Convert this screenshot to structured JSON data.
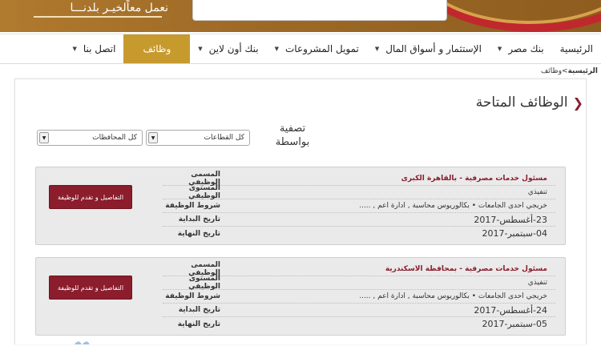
{
  "header": {
    "slogan": "نعمل معاًلخيـر بلدنـــا"
  },
  "nav": {
    "items": [
      {
        "label": "الرئيسية",
        "dropdown": false,
        "active": false
      },
      {
        "label": "بنك مصر",
        "dropdown": true,
        "active": false
      },
      {
        "label": "الإستثمار و أسواق المال",
        "dropdown": true,
        "active": false
      },
      {
        "label": "تمويل المشروعات",
        "dropdown": true,
        "active": false
      },
      {
        "label": "بنك أون لاين",
        "dropdown": true,
        "active": false
      },
      {
        "label": "وظائف",
        "dropdown": false,
        "active": true
      },
      {
        "label": "اتصل بنا",
        "dropdown": true,
        "active": false
      }
    ],
    "arrow_icon": "caret-down-icon"
  },
  "breadcrumb": {
    "home": "الرئيسية",
    "separator": ">",
    "current": "وظائف"
  },
  "page": {
    "title": "الوظائف المتاحة"
  },
  "filter": {
    "label": "تصفية بواسطة",
    "sector_value": "كل القطاعات",
    "governorate_value": "كل المحافظات"
  },
  "labels": {
    "title": "المسمى الوظيفي",
    "level": "المستوى الوظيفي",
    "conditions": "شروط الوظيفة",
    "start": "تاريخ البداية",
    "end": "تاريخ النهاية",
    "apply": "التفاصيل و تقدم للوظيفة"
  },
  "jobs": [
    {
      "title": "مسئول خدمات مصرفية - بالقاهرة الكبرى",
      "level": "تنفيذي",
      "conditions": "خريجي احدى الجامعات • بكالوريوس محاسبة , ادارة اعم , .....",
      "start": "23-أغسطس-2017",
      "end": "04-سبتمبر-2017"
    },
    {
      "title": "مسئول خدمات مصرفية - بمحافظة الاسكندرية",
      "level": "تنفيذي",
      "conditions": "خريجي احدى الجامعات • بكالوريوس محاسبة , ادارة اعم , .....",
      "start": "24-أغسطس-2017",
      "end": "05-سبتمبر-2017"
    }
  ],
  "colors": {
    "brand_red": "#8b1d2c",
    "brand_gold": "#c79a2e"
  }
}
